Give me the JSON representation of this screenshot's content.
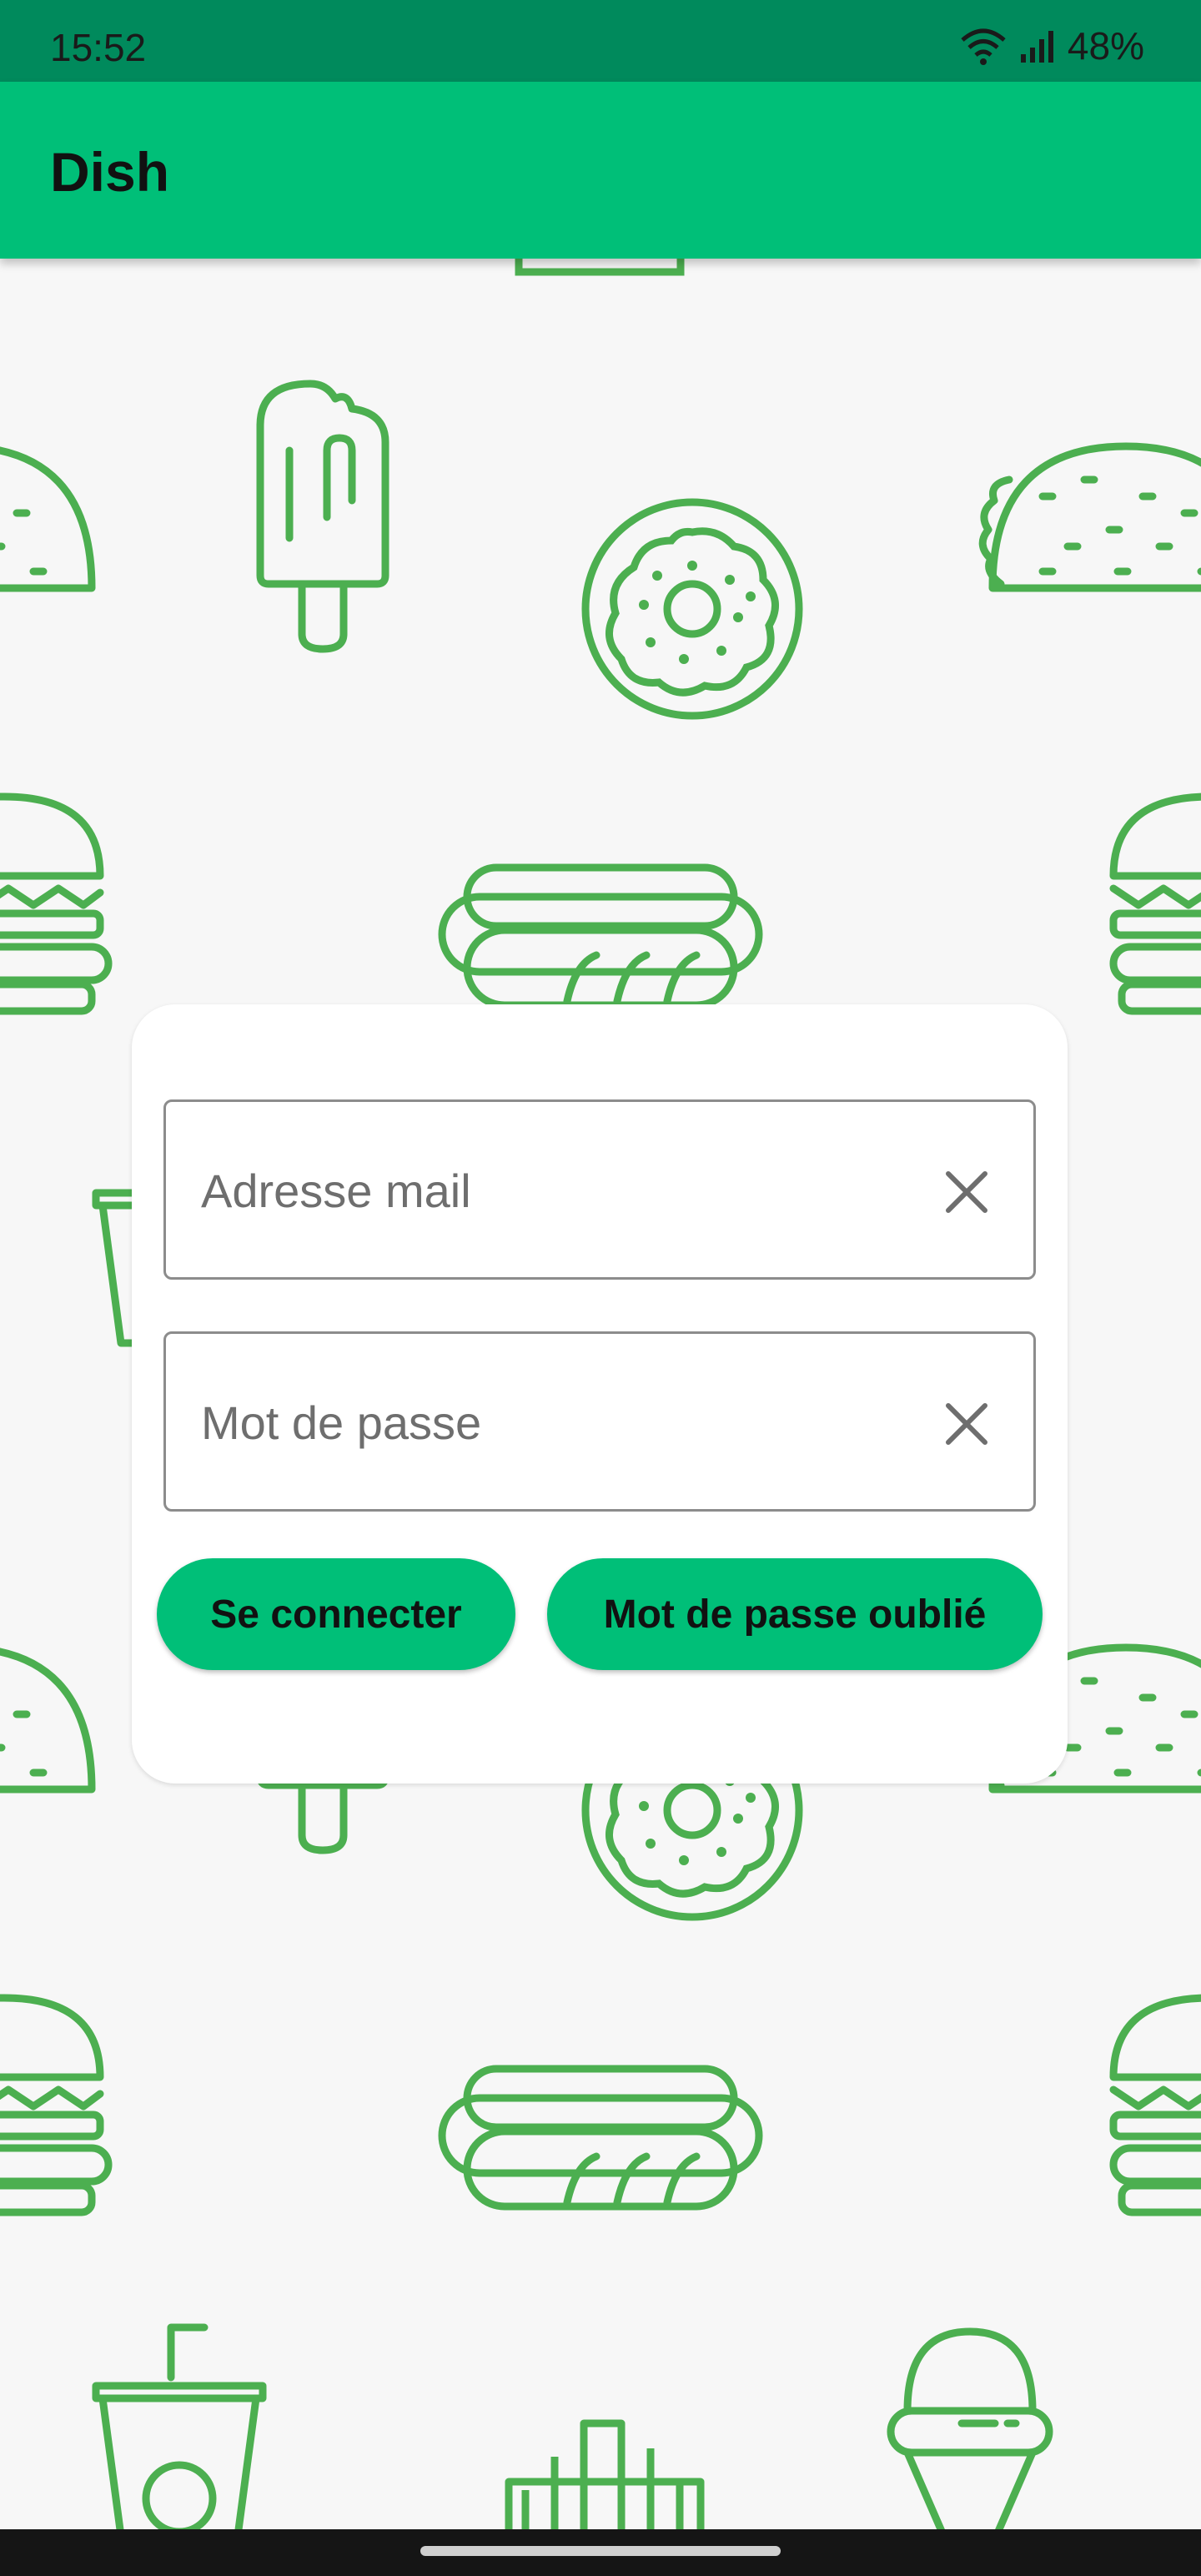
{
  "status_bar": {
    "time": "15:52",
    "battery": "48%",
    "icons": [
      "wifi-icon",
      "signal-icon"
    ]
  },
  "app_bar": {
    "title": "Dish"
  },
  "login_card": {
    "email_placeholder": "Adresse mail",
    "password_placeholder": "Mot de passe",
    "login_button": "Se connecter",
    "forgot_button": "Mot de passe oublié"
  },
  "colors": {
    "primary": "#00bf78",
    "status_bar": "#008a5c",
    "pattern": "#4caf50",
    "background": "#f7f7f7"
  },
  "background_icons": [
    "taco-icon",
    "popsicle-icon",
    "donut-icon",
    "burger-icon",
    "hotdog-icon",
    "drink-cup-icon",
    "fries-icon",
    "ice-cream-cone-icon"
  ]
}
